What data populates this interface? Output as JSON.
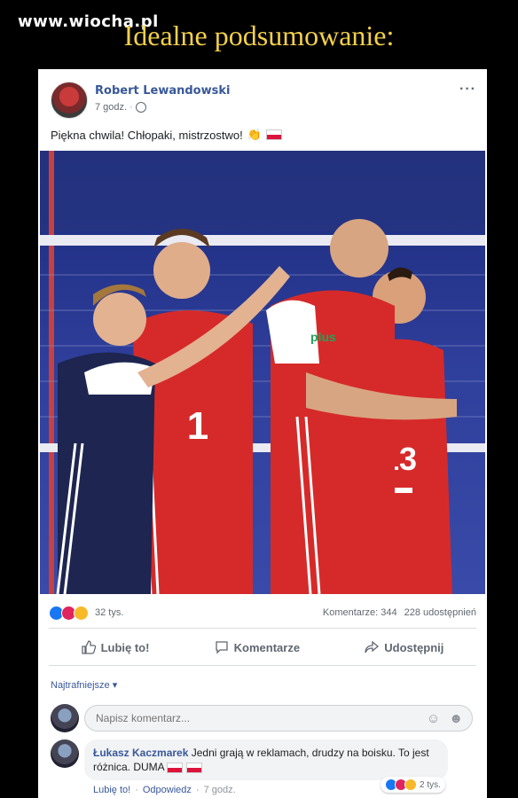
{
  "watermark": "www.wiocha.pl",
  "headline": "Idealne podsumowanie:",
  "post": {
    "author": "Robert Lewandowski",
    "time": "7 godz.",
    "text": "Piękna chwila! Chłopaki, mistrzostwo!",
    "more": "···"
  },
  "stats": {
    "reactions_count": "32 tys.",
    "comments": "Komentarze: 344",
    "shares": "228 udostępnień"
  },
  "actions": {
    "like": "Lubię to!",
    "comment": "Komentarze",
    "share": "Udostępnij"
  },
  "sort_label": "Najtrafniejsze",
  "compose": {
    "placeholder": "Napisz komentarz..."
  },
  "comment": {
    "author": "Łukasz Kaczmarek",
    "text": "Jedni grają w reklamach, drudzy na boisku. To jest różnica. DUMA",
    "reactions_count": "2 tys.",
    "like": "Lubię to!",
    "reply": "Odpowiedz",
    "time": "7 godz."
  },
  "photo": {
    "jersey_numbers": [
      "1",
      "13"
    ],
    "sponsor": "plus"
  },
  "colors": {
    "link": "#385898",
    "headline": "#f3d04b",
    "jersey_red": "#d62a2a",
    "court_blue": "#2b3a8f"
  }
}
